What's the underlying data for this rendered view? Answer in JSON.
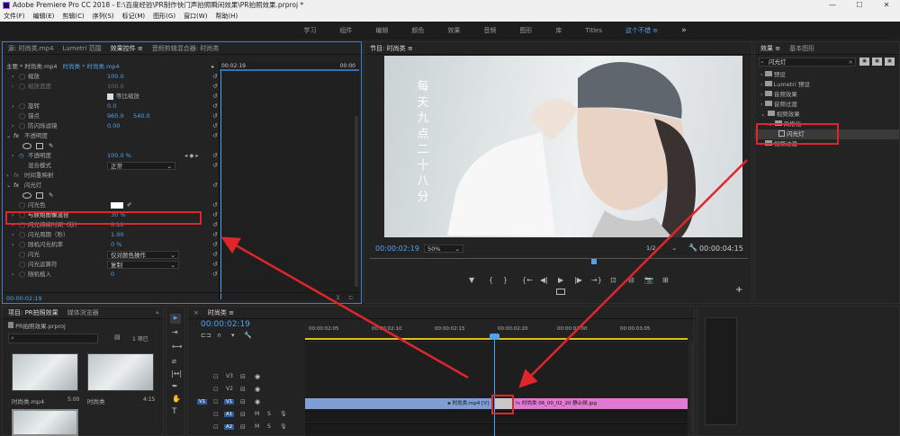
{
  "title_bar": {
    "text": "Adobe Premiere Pro CC 2018 - E:\\百度经验\\PR制作快门声拍照瞬间效果\\PR拍照效果.prproj *",
    "min": "—",
    "max": "☐",
    "close": "✕"
  },
  "menu": [
    "文件(F)",
    "编辑(E)",
    "剪辑(C)",
    "序列(S)",
    "标记(M)",
    "图形(G)",
    "窗口(W)",
    "帮助(H)"
  ],
  "workspaces": {
    "items": [
      "学习",
      "组件",
      "编辑",
      "颜色",
      "效果",
      "音频",
      "图形",
      "库",
      "Titles"
    ],
    "active": "这个不错",
    "menu": "≡",
    "more": "»"
  },
  "effect_controls": {
    "tabs": [
      "源: 时尚类.mp4",
      "Lumetri 范围",
      "效果控件",
      "音频剪辑混合器: 时尚类"
    ],
    "active_tab_menu": "≡",
    "header_clip": "主要 * 时尚类.mp4",
    "header_seq": "时尚类 * 时尚类.mp4",
    "timecode_mini": "00:02:19",
    "timecode_mini_end": "00:00",
    "rows": [
      {
        "label": "缩放",
        "value": "100.0"
      },
      {
        "label": "缩放宽度",
        "value": "100.0"
      },
      {
        "label": "等比缩放",
        "value": ""
      },
      {
        "label": "旋转",
        "value": "0.0"
      },
      {
        "label": "锚点",
        "value": "960.0     540.0"
      },
      {
        "label": "防闪烁滤镜",
        "value": "0.00"
      },
      {
        "label": "不透明度",
        "value": ""
      },
      {
        "label": "",
        "value": ""
      },
      {
        "label": "不透明度",
        "value": "100.0 %"
      },
      {
        "label": "混合模式",
        "value": "正常"
      },
      {
        "label": "时间重映射",
        "value": ""
      },
      {
        "label": "闪光灯",
        "value": ""
      },
      {
        "label": "",
        "value": ""
      },
      {
        "label": "闪光色",
        "value": ""
      },
      {
        "label": "与原始图像混合",
        "value": "30 %"
      },
      {
        "label": "闪光持续时间（秒）",
        "value": "0.10"
      },
      {
        "label": "闪光周期（秒）",
        "value": "1.00"
      },
      {
        "label": "随机闪光机率",
        "value": "0 %"
      },
      {
        "label": "闪光",
        "value": "仅对颜色操作"
      },
      {
        "label": "闪光运算符",
        "value": "复制"
      },
      {
        "label": "随机植入",
        "value": "0"
      }
    ],
    "footer_tc": "00:00:02:19"
  },
  "program": {
    "title": "节目: 时尚类",
    "menu": "≡",
    "vertical_text": [
      "每",
      "天",
      "九",
      "点",
      "二",
      "十",
      "八",
      "分"
    ],
    "timecode": "00:00:02:19",
    "zoom": "50%",
    "fraction": "1/2",
    "duration": "00:00:04:15",
    "controls": [
      "▼",
      "{",
      "}",
      "{←",
      "◀|",
      "▶",
      "|▶",
      "→}",
      "⊡",
      "⊟",
      "📷",
      "⊞"
    ],
    "plus": "+"
  },
  "effects_panel": {
    "tabs": [
      "效果",
      "基本图形"
    ],
    "menu": "≡",
    "search": "闪光灯",
    "tree": [
      {
        "label": "预设",
        "indent": 0,
        "folder": true
      },
      {
        "label": "Lumetri 预设",
        "indent": 0,
        "folder": true
      },
      {
        "label": "音频效果",
        "indent": 0,
        "folder": true
      },
      {
        "label": "音频过渡",
        "indent": 0,
        "folder": true
      },
      {
        "label": "视频效果",
        "indent": 0,
        "folder": true,
        "open": true
      },
      {
        "label": "风格化",
        "indent": 1,
        "folder": true,
        "open": true
      },
      {
        "label": "闪光灯",
        "indent": 2,
        "folder": false,
        "selected": true
      },
      {
        "label": "视频过渡",
        "indent": 0,
        "folder": true
      }
    ]
  },
  "project": {
    "tabs": [
      "项目: PR拍照效果",
      "媒体浏览器"
    ],
    "more": "»",
    "file": "PR拍照效果.prproj",
    "selected": "1 项已",
    "items": [
      {
        "name": "时尚类.mp4",
        "dur": "5:00"
      },
      {
        "name": "时尚类",
        "dur": "4:15"
      }
    ]
  },
  "timeline": {
    "tab": "时尚类",
    "menu": "≡",
    "close": "×",
    "timecode": "00:00:02:19",
    "ruler": [
      "00:00:02:05",
      "00:00:02:10",
      "00:00:02:15",
      "00:00:02:20",
      "00:00:03:00",
      "00:00:03:05"
    ],
    "tracks": [
      "V3",
      "V2",
      "V1",
      "A1",
      "A2"
    ],
    "v1_src": "V1",
    "clip1": "时尚类.mp4 [V]",
    "clip2_badge": "fx",
    "clip2": "时尚类 06_00_02_20 静止帧.jpg"
  },
  "colors": {
    "accent": "#4ea3ef",
    "arrow": "#e0262a",
    "clip_blue": "#7f9fd4",
    "clip_pink": "#e07ad2",
    "work_area": "#d6c41c"
  }
}
